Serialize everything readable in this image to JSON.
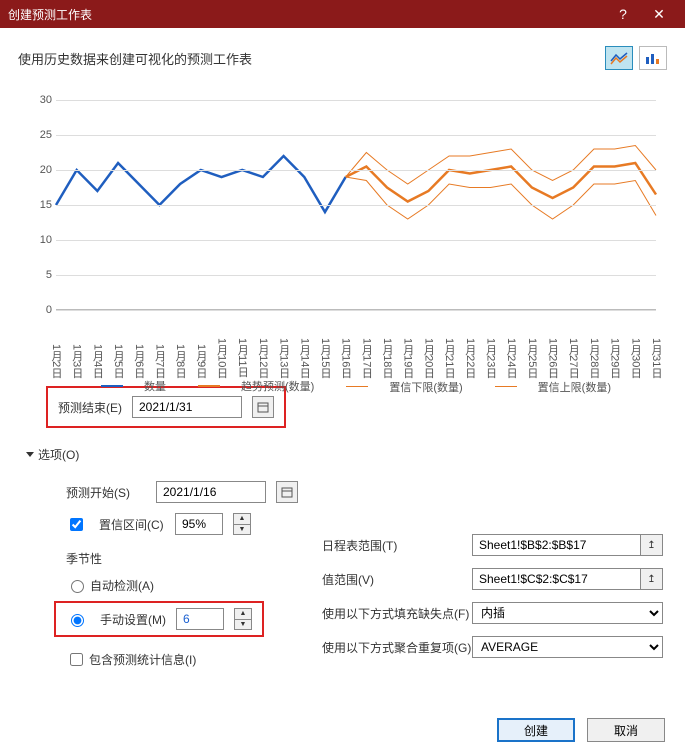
{
  "window": {
    "title": "创建预测工作表"
  },
  "subtitle": "使用历史数据来创建可视化的预测工作表",
  "chart_data": {
    "type": "line",
    "xlabel": "",
    "ylabel": "",
    "ylim": [
      0,
      30
    ],
    "yticks": [
      0,
      5,
      10,
      15,
      20,
      25,
      30
    ],
    "categories": [
      "1月2日",
      "1月3日",
      "1月4日",
      "1月5日",
      "1月6日",
      "1月7日",
      "1月8日",
      "1月9日",
      "1月10日",
      "1月11日",
      "1月12日",
      "1月13日",
      "1月14日",
      "1月15日",
      "1月16日",
      "1月17日",
      "1月18日",
      "1月19日",
      "1月20日",
      "1月21日",
      "1月22日",
      "1月23日",
      "1月24日",
      "1月25日",
      "1月26日",
      "1月27日",
      "1月28日",
      "1月29日",
      "1月30日",
      "1月31日"
    ],
    "series": [
      {
        "name": "数量",
        "color": "#1f5ebf",
        "width": 2.5,
        "x": [
          0,
          1,
          2,
          3,
          4,
          5,
          6,
          7,
          8,
          9,
          10,
          11,
          12,
          13,
          14
        ],
        "values": [
          15,
          20,
          17,
          21,
          18,
          15,
          18,
          20,
          19,
          20,
          19,
          22,
          19,
          14,
          19
        ]
      },
      {
        "name": "趋势预测(数量)",
        "color": "#e77a24",
        "width": 2.5,
        "x": [
          14,
          15,
          16,
          17,
          18,
          19,
          20,
          21,
          22,
          23,
          24,
          25,
          26,
          27,
          28,
          29
        ],
        "values": [
          19,
          20.5,
          17.5,
          15.5,
          17,
          20,
          19.5,
          20,
          20.5,
          17.5,
          16,
          17.5,
          20.5,
          20.5,
          21,
          16.5
        ]
      },
      {
        "name": "置信下限(数量)",
        "color": "#e77a24",
        "width": 1,
        "x": [
          14,
          15,
          16,
          17,
          18,
          19,
          20,
          21,
          22,
          23,
          24,
          25,
          26,
          27,
          28,
          29
        ],
        "values": [
          19,
          18.5,
          15,
          13,
          15,
          18,
          17.5,
          17.5,
          18,
          15,
          13,
          15,
          18,
          18,
          18.5,
          13.5
        ]
      },
      {
        "name": "置信上限(数量)",
        "color": "#e77a24",
        "width": 1,
        "x": [
          14,
          15,
          16,
          17,
          18,
          19,
          20,
          21,
          22,
          23,
          24,
          25,
          26,
          27,
          28,
          29
        ],
        "values": [
          19,
          22.5,
          20,
          18,
          20,
          22,
          22,
          22.5,
          23,
          20,
          18.5,
          20,
          23,
          23,
          23.5,
          20
        ]
      }
    ]
  },
  "form": {
    "forecast_end_label": "预测结束(E)",
    "forecast_end_value": "2021/1/31",
    "options_label": "选项(O)",
    "forecast_start_label": "预测开始(S)",
    "forecast_start_value": "2021/1/16",
    "confidence_label": "置信区间(C)",
    "confidence_value": "95%",
    "seasonality_heading": "季节性",
    "auto_detect_label": "自动检测(A)",
    "manual_label": "手动设置(M)",
    "manual_value": "6",
    "include_stats_label": "包含预测统计信息(I)",
    "timeline_range_label": "日程表范围(T)",
    "timeline_range_value": "Sheet1!$B$2:$B$17",
    "values_range_label": "值范围(V)",
    "values_range_value": "Sheet1!$C$2:$C$17",
    "fill_missing_label": "使用以下方式填充缺失点(F)",
    "fill_missing_value": "内插",
    "aggregate_label": "使用以下方式聚合重复项(G)",
    "aggregate_value": "AVERAGE"
  },
  "buttons": {
    "create": "创建",
    "cancel": "取消"
  }
}
